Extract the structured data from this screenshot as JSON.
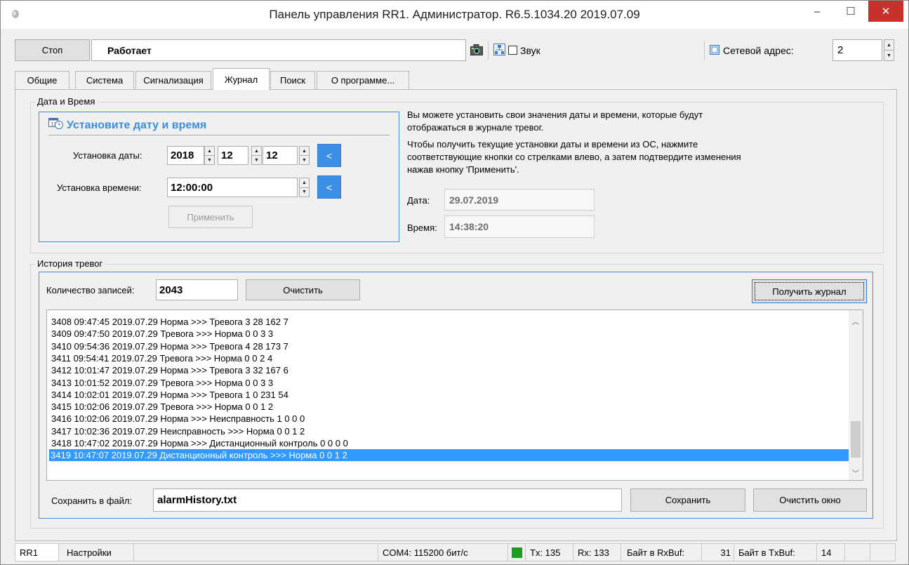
{
  "window": {
    "title": "Панель управления RR1. Администратор. R6.5.1034.20 2019.07.09",
    "min_glyph": "–",
    "max_glyph": "☐",
    "close_glyph": "✕"
  },
  "toolbar": {
    "stop_label": "Стоп",
    "status_text": "Работает",
    "sound_label": "Звук",
    "network_address_label": "Сетевой адрес:",
    "network_address_value": "2",
    "icons": [
      "camera-icon",
      "network-icon",
      "network-address-icon"
    ]
  },
  "tabs": [
    {
      "label": "Общие"
    },
    {
      "label": "Система"
    },
    {
      "label": "Сигнализация"
    },
    {
      "label": "Журнал",
      "active": true
    },
    {
      "label": "Поиск"
    },
    {
      "label": "О программе..."
    }
  ],
  "datetime_group": {
    "title": "Дата и Время",
    "heading": "Установите дату и время",
    "date_label": "Установка даты:",
    "date_year": "2018",
    "date_month": "12",
    "date_day": "12",
    "time_label": "Установка времени:",
    "time_value": "12:00:00",
    "arrow_label": "<",
    "apply_label": "Применить",
    "info_line1": "Вы можете установить свои значения даты и времени, которые будут",
    "info_line2": "отображаться в журнале тревог.",
    "info_line3": "Чтобы получить текущие установки даты и времени из ОС, нажмите",
    "info_line4": "соответствующие кнопки со стрелками влево, а затем подтвердите изменения",
    "info_line5": "нажав кнопку 'Применить'.",
    "current_date_label": "Дата:",
    "current_date_value": "29.07.2019",
    "current_time_label": "Время:",
    "current_time_value": "14:38:20"
  },
  "history_group": {
    "title": "История тревог",
    "count_label": "Количество записей:",
    "count_value": "2043",
    "clear_label": "Очистить",
    "get_log_label": "Получить журнал",
    "entries": [
      "3408 09:47:45 2019.07.29 Норма >>> Тревога 3 28 162 7",
      "3409 09:47:50 2019.07.29 Тревога >>> Норма 0 0 3 3",
      "3410 09:54:36 2019.07.29 Норма >>> Тревога 4 28 173 7",
      "3411 09:54:41 2019.07.29 Тревога >>> Норма 0 0 2 4",
      "3412 10:01:47 2019.07.29 Норма >>> Тревога 3 32 167 6",
      "3413 10:01:52 2019.07.29 Тревога >>> Норма 0 0 3 3",
      "3414 10:02:01 2019.07.29 Норма >>> Тревога 1 0 231 54",
      "3415 10:02:06 2019.07.29 Тревога >>> Норма 0 0 1 2",
      "3416 10:02:06 2019.07.29 Норма >>> Неисправность 1 0 0 0",
      "3417 10:02:36 2019.07.29 Неисправность >>> Норма 0 0 1 2",
      "3418 10:47:02 2019.07.29 Норма >>> Дистанционный контроль 0 0 0 0",
      "3419 10:47:07 2019.07.29 Дистанционный контроль >>> Норма 0 0 1 2"
    ],
    "selected_entry": 11,
    "save_file_label": "Сохранить в файл:",
    "save_file_value": "alarmHistory.txt",
    "save_label": "Сохранить",
    "clear_window_label": "Очистить окно"
  },
  "statusbar": {
    "tab_rr1": "RR1",
    "tab_settings": "Настройки",
    "port": "COM4: 115200 бит/с",
    "tx": "Tx: 135",
    "rx": "Rx: 133",
    "rxbuf_label": "Байт в RxBuf:",
    "rxbuf_value": "31",
    "txbuf_label": "Байт в TxBuf:",
    "txbuf_value": "14",
    "indicator_color": "#1e9e1e"
  },
  "colors": {
    "accent": "#3c8ee5",
    "selection": "#3398ff",
    "close": "#c7302b"
  }
}
